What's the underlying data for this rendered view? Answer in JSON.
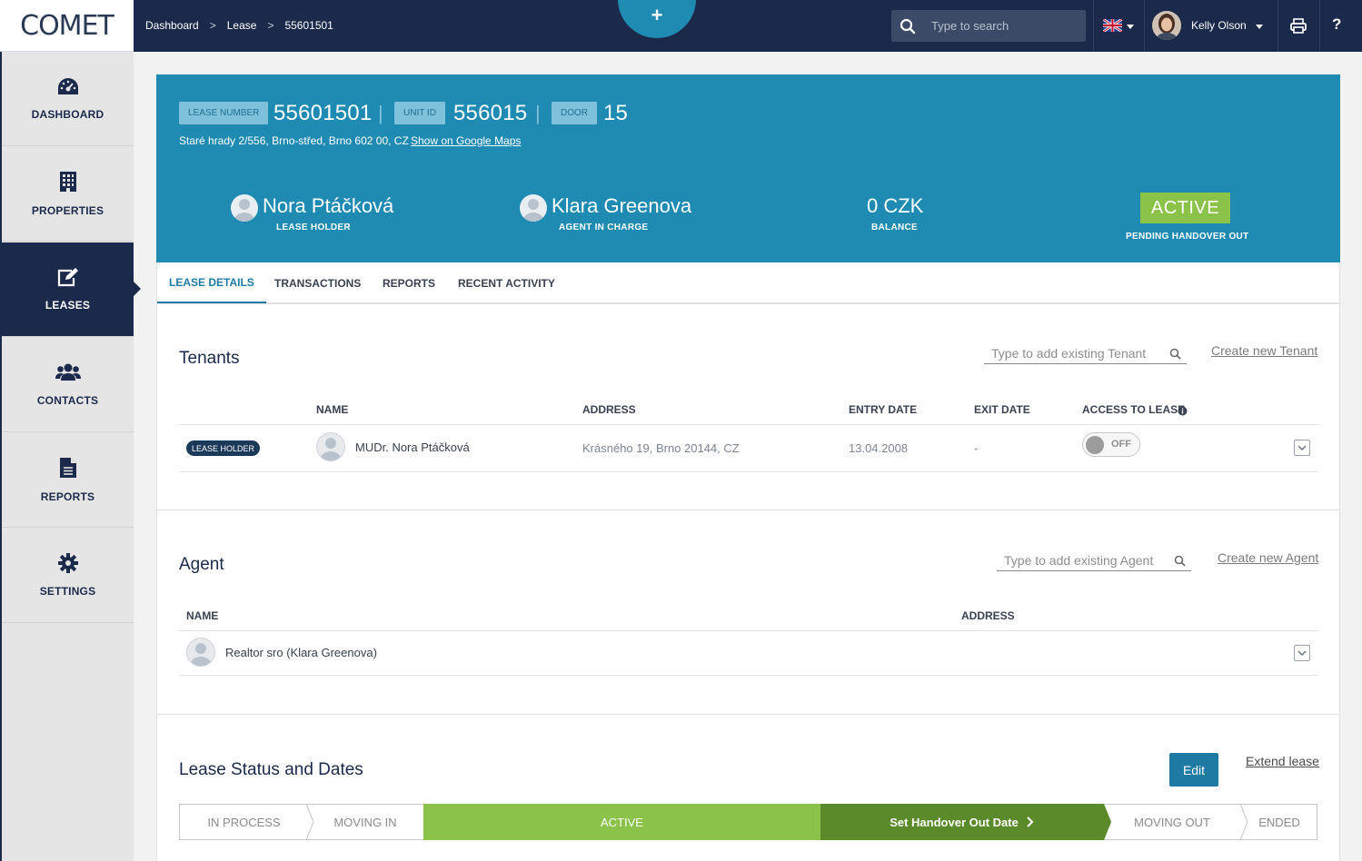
{
  "app": {
    "logo": "COMET"
  },
  "breadcrumb": [
    "Dashboard",
    "Lease",
    "55601501"
  ],
  "breadcrumb_sep": ">",
  "search": {
    "placeholder": "Type to search"
  },
  "user": {
    "name": "Kelly Olson"
  },
  "help_label": "?",
  "quick_add_label": "+",
  "sidebar": {
    "items": [
      {
        "label": "DASHBOARD",
        "icon": "dashboard-icon"
      },
      {
        "label": "PROPERTIES",
        "icon": "building-icon"
      },
      {
        "label": "LEASES",
        "icon": "edit-icon",
        "active": true
      },
      {
        "label": "CONTACTS",
        "icon": "users-icon"
      },
      {
        "label": "REPORTS",
        "icon": "file-icon"
      },
      {
        "label": "SETTINGS",
        "icon": "gear-icon"
      }
    ]
  },
  "lease": {
    "lease_number_label": "LEASE NUMBER",
    "lease_number": "55601501",
    "unit_id_label": "UNIT ID",
    "unit_id": "556015",
    "door_label": "DOOR",
    "door": "15",
    "address": "Staré hrady 2/556, Brno-střed, Brno 602 00, CZ",
    "maps_link": "Show on Google Maps",
    "holder_name": "Nora Ptáčková",
    "holder_role": "LEASE HOLDER",
    "agent_name": "Klara Greenova",
    "agent_role": "AGENT IN CHARGE",
    "balance": "0 CZK",
    "balance_label": "BALANCE",
    "status": "ACTIVE",
    "status_sub": "PENDING HANDOVER OUT",
    "status_color": "#8bc34a",
    "header_color": "#1f8bb3"
  },
  "tabs": [
    "LEASE DETAILS",
    "TRANSACTIONS",
    "REPORTS",
    "RECENT ACTIVITY"
  ],
  "tenants": {
    "title": "Tenants",
    "search_placeholder": "Type to add existing Tenant",
    "create_link": "Create new Tenant",
    "columns": [
      "NAME",
      "ADDRESS",
      "ENTRY DATE",
      "EXIT DATE",
      "ACCESS TO LEASE"
    ],
    "rows": [
      {
        "badge": "LEASE HOLDER",
        "name": "MUDr. Nora Ptáčková",
        "address": "Krásného 19, Brno 20144, CZ",
        "entry_date": "13.04.2008",
        "exit_date": "-",
        "access": "OFF"
      }
    ]
  },
  "agent": {
    "title": "Agent",
    "search_placeholder": "Type to add existing Agent",
    "create_link": "Create new Agent",
    "columns": [
      "NAME",
      "ADDRESS"
    ],
    "rows": [
      {
        "name": "Realtor sro (Klara Greenova)",
        "address": ""
      }
    ]
  },
  "status_section": {
    "title": "Lease Status and Dates",
    "edit_label": "Edit",
    "extend_link": "Extend lease",
    "steps": [
      "IN PROCESS",
      "MOVING IN",
      "ACTIVE",
      "Set Handover Out Date",
      "MOVING OUT",
      "ENDED"
    ],
    "action_color": "#5a8a2a"
  }
}
